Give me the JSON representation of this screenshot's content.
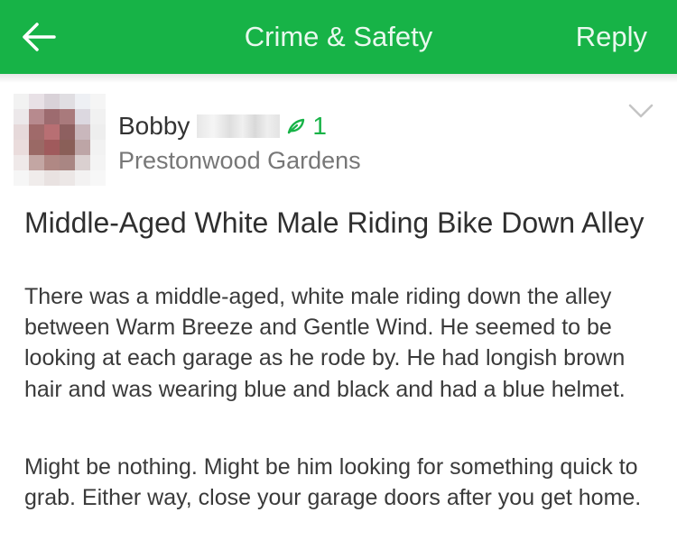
{
  "nav": {
    "title": "Crime & Safety",
    "reply_label": "Reply",
    "back_icon": "arrow-left-icon",
    "color": "#17b347"
  },
  "post": {
    "author_first_name": "Bobby",
    "agree_icon": "leaf-icon",
    "agree_count": "1",
    "neighborhood": "Prestonwood Gardens",
    "menu_icon": "chevron-down-icon",
    "title": "Middle-Aged White Male Riding Bike Down Alley",
    "paragraphs": [
      "There was a middle-aged, white male riding down the alley between Warm Breeze and Gentle Wind. He seemed to be looking at each garage as he rode by. He had longish brown hair and was wearing blue and black and had a blue helmet.",
      "Might be nothing. Might be him looking for something quick to grab. Either way, close your garage doors after you get home."
    ]
  }
}
